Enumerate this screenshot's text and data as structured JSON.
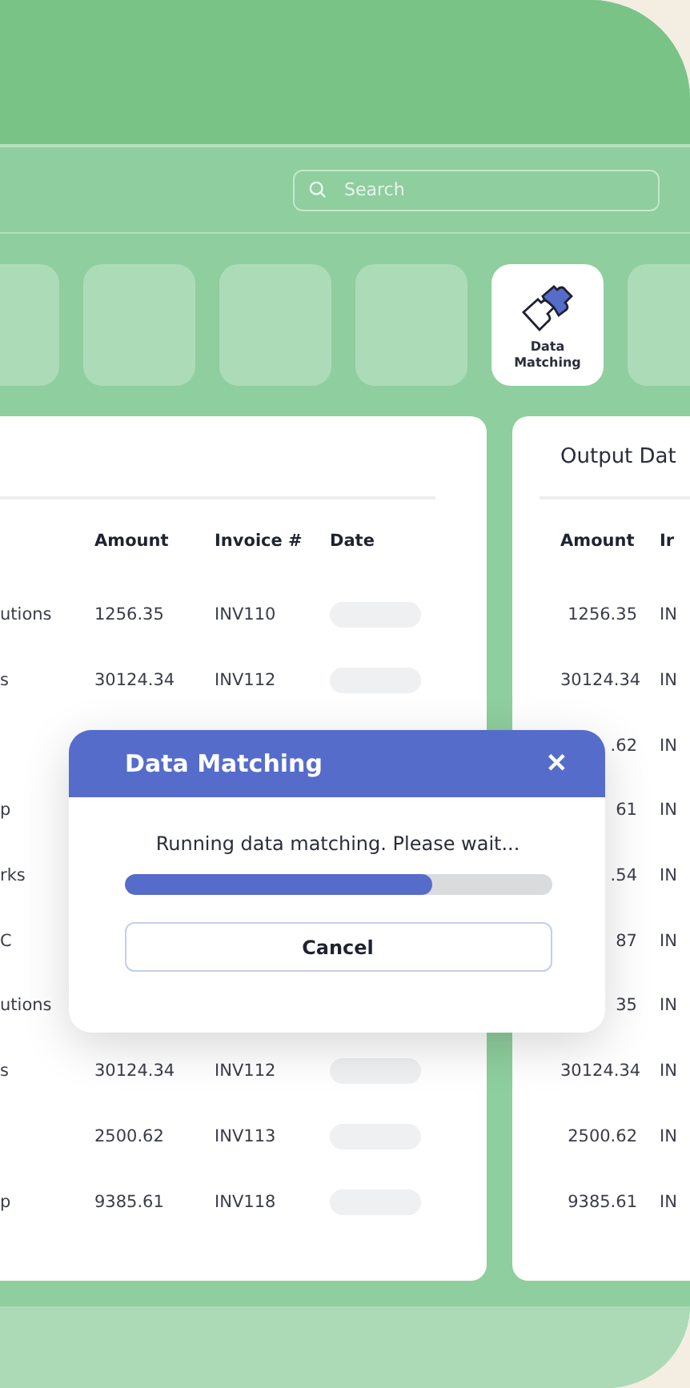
{
  "search": {
    "placeholder": "Search"
  },
  "tiles": [
    {
      "selected": false
    },
    {
      "selected": false
    },
    {
      "selected": false
    },
    {
      "selected": false
    },
    {
      "label": "Data Matching",
      "selected": true
    },
    {
      "selected": false
    }
  ],
  "input_table": {
    "columns": [
      "Amount",
      "Invoice #",
      "Date"
    ],
    "rows": [
      {
        "name": "utions",
        "amount": "1256.35",
        "invoice": "INV110"
      },
      {
        "name": "s",
        "amount": "30124.34",
        "invoice": "INV112"
      },
      {
        "name": "",
        "amount": "",
        "invoice": ""
      },
      {
        "name": "p",
        "amount": "",
        "invoice": ""
      },
      {
        "name": "rks",
        "amount": "",
        "invoice": ""
      },
      {
        "name": "C",
        "amount": "",
        "invoice": ""
      },
      {
        "name": "utions",
        "amount": "",
        "invoice": ""
      },
      {
        "name": "s",
        "amount": "30124.34",
        "invoice": "INV112"
      },
      {
        "name": "",
        "amount": "2500.62",
        "invoice": "INV113"
      },
      {
        "name": "p",
        "amount": "9385.61",
        "invoice": "INV118"
      }
    ]
  },
  "output_table": {
    "title": "Output Dat",
    "columns": [
      "Amount",
      "Ir"
    ],
    "rows": [
      {
        "amount": "1256.35",
        "invoice": "IN"
      },
      {
        "amount": "30124.34",
        "invoice": "IN"
      },
      {
        "amount": ".62",
        "invoice": "IN"
      },
      {
        "amount": "61",
        "invoice": "IN"
      },
      {
        "amount": ".54",
        "invoice": "IN"
      },
      {
        "amount": "87",
        "invoice": "IN"
      },
      {
        "amount": "35",
        "invoice": "IN"
      },
      {
        "amount": "30124.34",
        "invoice": "IN"
      },
      {
        "amount": "2500.62",
        "invoice": "IN"
      },
      {
        "amount": "9385.61",
        "invoice": "IN"
      }
    ]
  },
  "dialog": {
    "title": "Data Matching",
    "close": "✕",
    "message": "Running data matching. Please wait...",
    "level": 0.72,
    "button": "Cancel"
  }
}
